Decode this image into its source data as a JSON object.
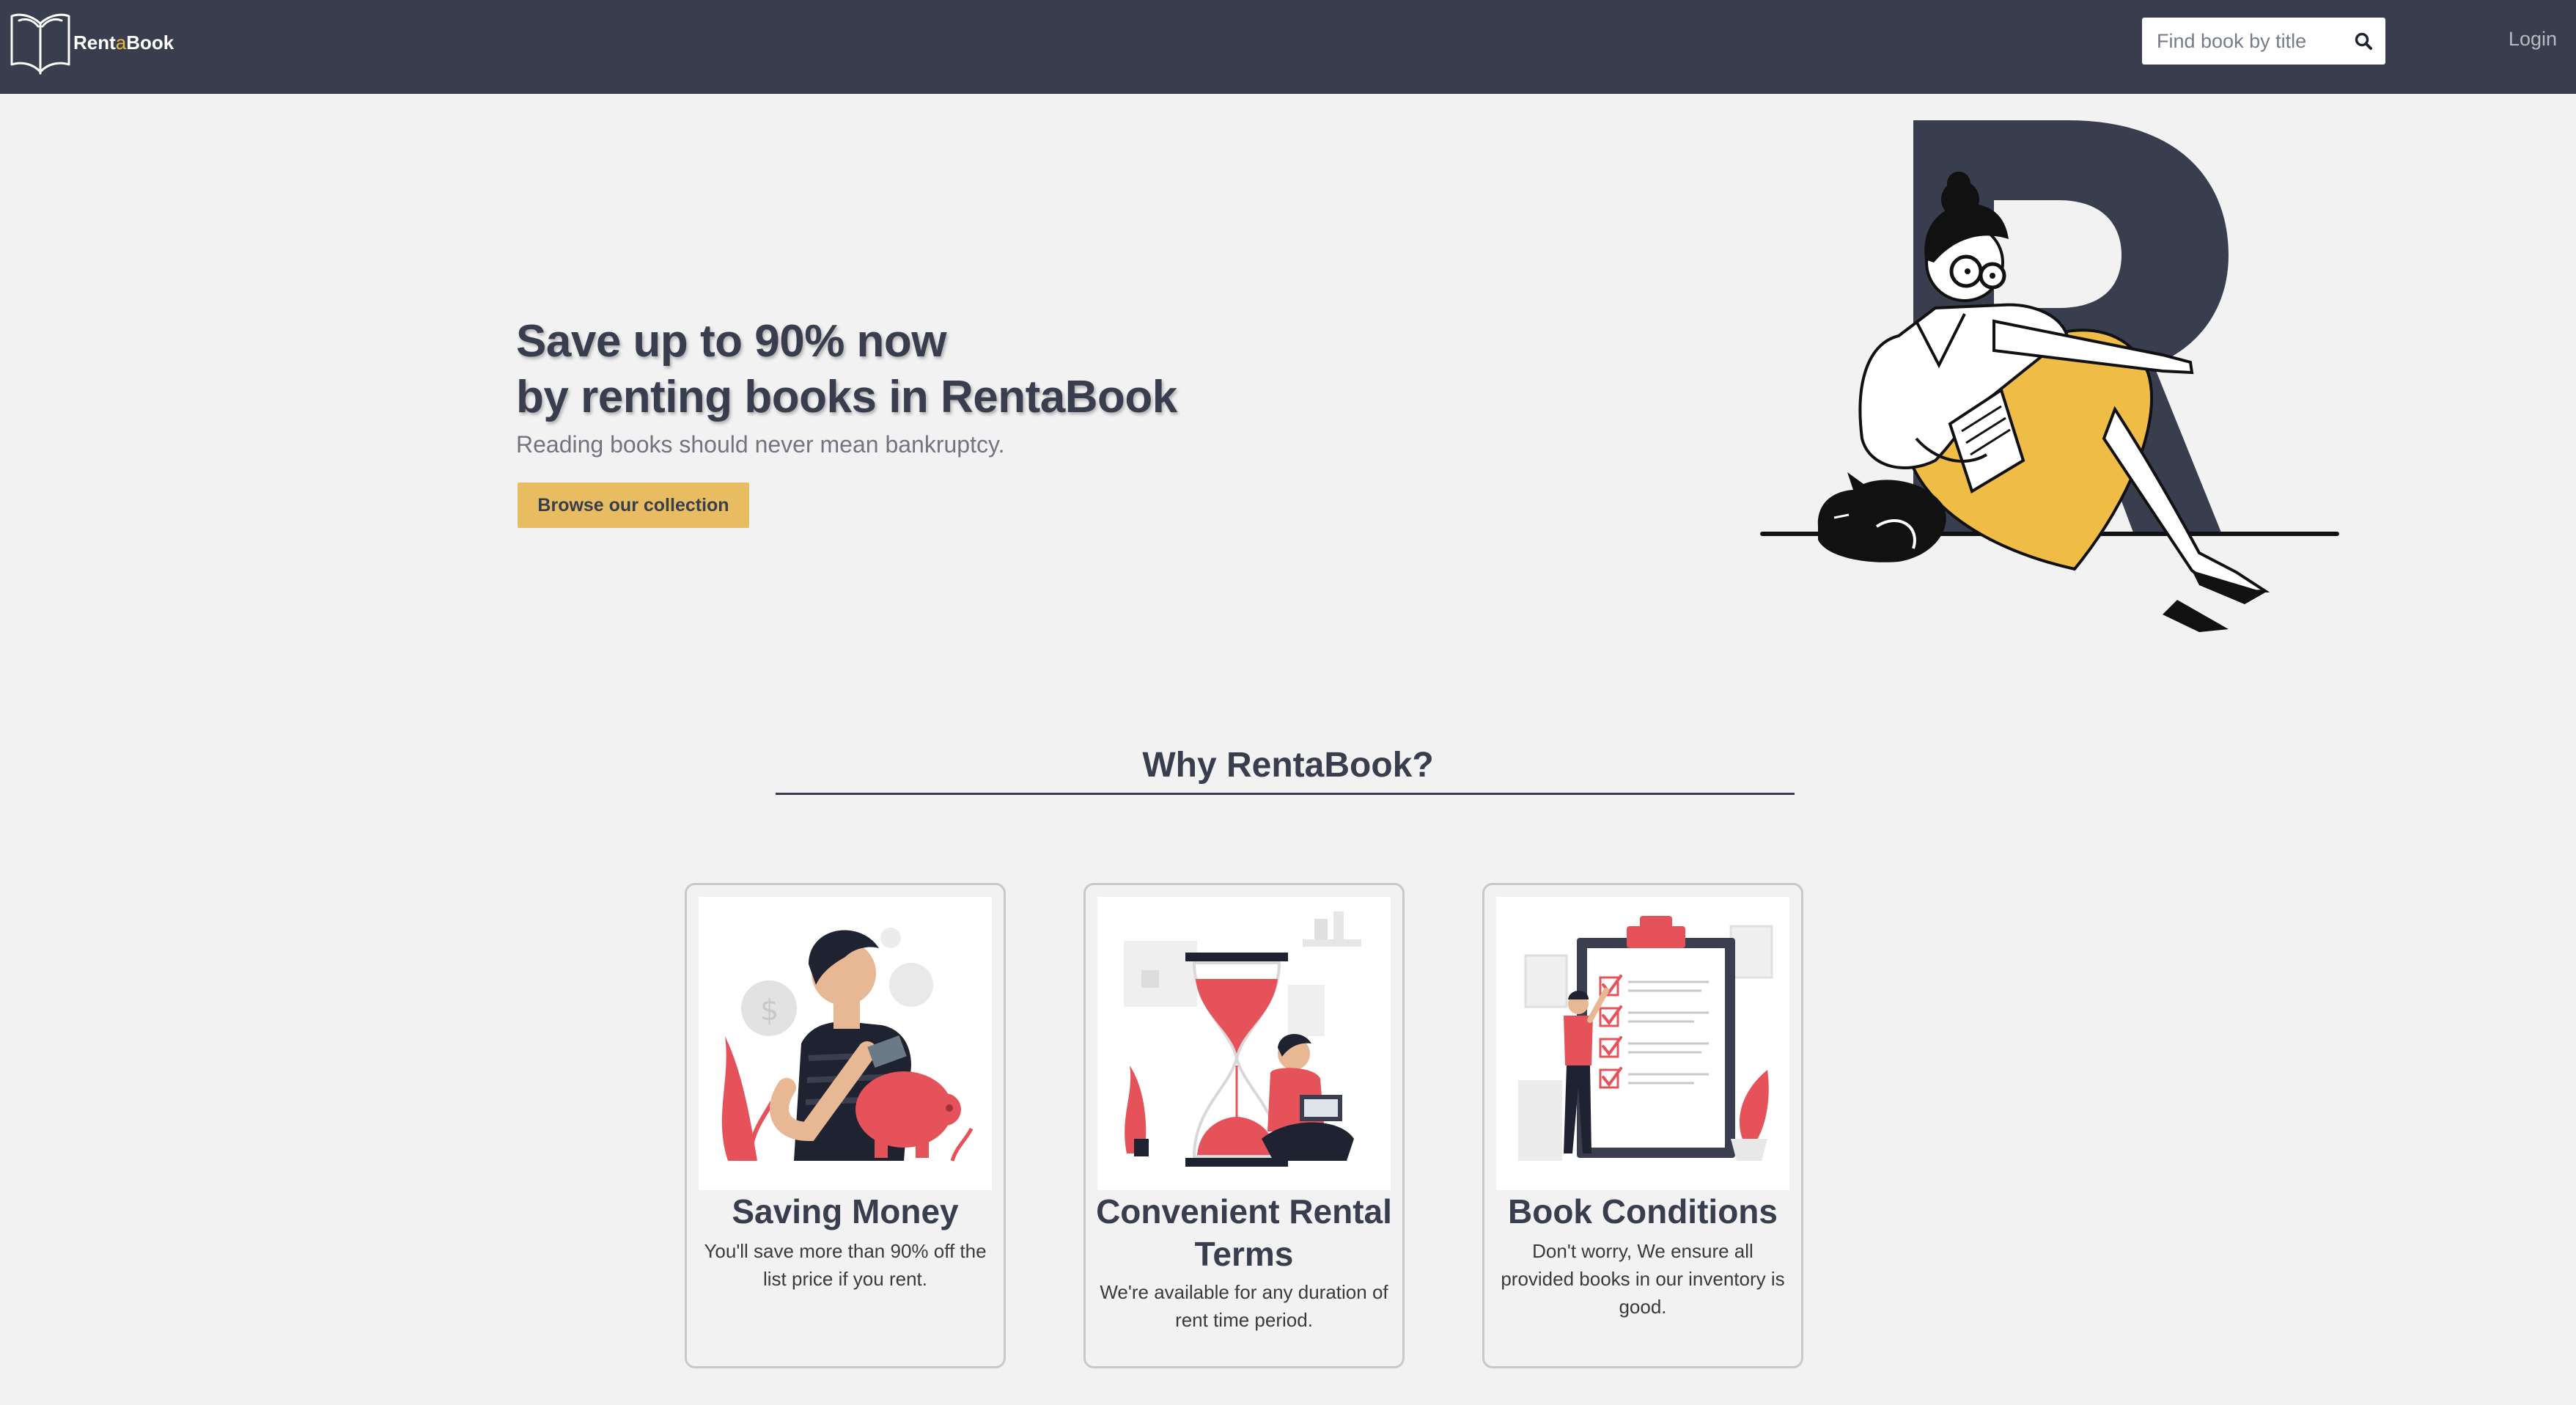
{
  "navbar": {
    "brand": {
      "part1": "Rent",
      "part2": "a",
      "part3": "Book",
      "logo_icon": "open-book-icon"
    },
    "search": {
      "placeholder": "Find book by title",
      "value": "",
      "icon": "search-icon"
    },
    "login_label": "Login"
  },
  "hero": {
    "title_line1": "Save up to 90% now",
    "title_line2": "by renting books in RentaBook",
    "subtitle": "Reading books should never mean bankruptcy.",
    "cta_label": "Browse our collection",
    "illustration": "woman-reading-with-cat-illustration"
  },
  "why": {
    "title": "Why RentaBook?",
    "cards": [
      {
        "title": "Saving Money",
        "text": "You'll save more than 90% off the list price if you rent.",
        "illustration": "piggy-bank-illustration"
      },
      {
        "title": "Convenient Rental Terms",
        "text": "We're available for any duration of rent time period.",
        "illustration": "hourglass-illustration"
      },
      {
        "title": "Book Conditions",
        "text": "Don't worry, We ensure all provided books in our inventory is good.",
        "illustration": "checklist-illustration"
      }
    ]
  },
  "colors": {
    "navbar": "#393e4f",
    "accent_yellow": "#e8bd62",
    "accent_red": "#e6525a",
    "background": "#f2f2f2"
  }
}
